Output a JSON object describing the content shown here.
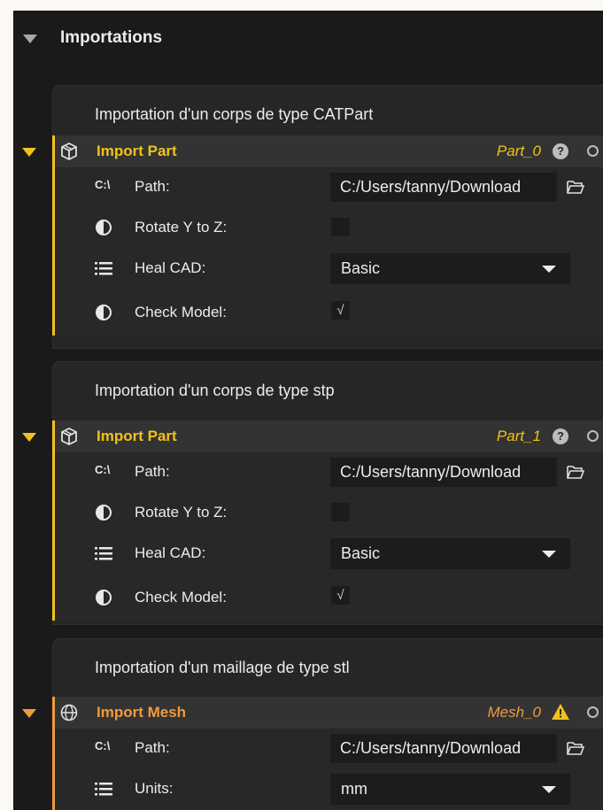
{
  "section": {
    "title": "Importations",
    "collapse_icon": "triangle-down-icon"
  },
  "groups": [
    {
      "title": "Importation d'un corps de type CATPart",
      "node": {
        "label": "Import Part",
        "name": "Part_0",
        "accent": "#f2c21b",
        "icon": "cube-icon",
        "status_icon": "help-icon",
        "help_glyph": "?",
        "path": {
          "label": "Path:",
          "icon_text": "C:\\",
          "value": "C:/Users/tanny/Download"
        },
        "rotate": {
          "label": "Rotate Y to Z:",
          "checked": false
        },
        "heal": {
          "label": "Heal CAD:",
          "value": "Basic"
        },
        "check": {
          "label": "Check Model:",
          "checked": true,
          "mark": "√"
        }
      }
    },
    {
      "title": "Importation d'un corps de type stp",
      "node": {
        "label": "Import Part",
        "name": "Part_1",
        "accent": "#f2c21b",
        "icon": "cube-icon",
        "status_icon": "help-icon",
        "help_glyph": "?",
        "path": {
          "label": "Path:",
          "icon_text": "C:\\",
          "value": "C:/Users/tanny/Download"
        },
        "rotate": {
          "label": "Rotate Y to Z:",
          "checked": false
        },
        "heal": {
          "label": "Heal CAD:",
          "value": "Basic"
        },
        "check": {
          "label": "Check Model:",
          "checked": true,
          "mark": "√"
        }
      }
    },
    {
      "title": "Importation d'un maillage de type stl",
      "node": {
        "label": "Import Mesh",
        "name": "Mesh_0",
        "accent": "#f19a3b",
        "icon": "globe-icon",
        "status_icon": "warning-icon",
        "path": {
          "label": "Path:",
          "icon_text": "C:\\",
          "value": "C:/Users/tanny/Download"
        },
        "units": {
          "label": "Units:",
          "value": "mm"
        }
      }
    }
  ]
}
